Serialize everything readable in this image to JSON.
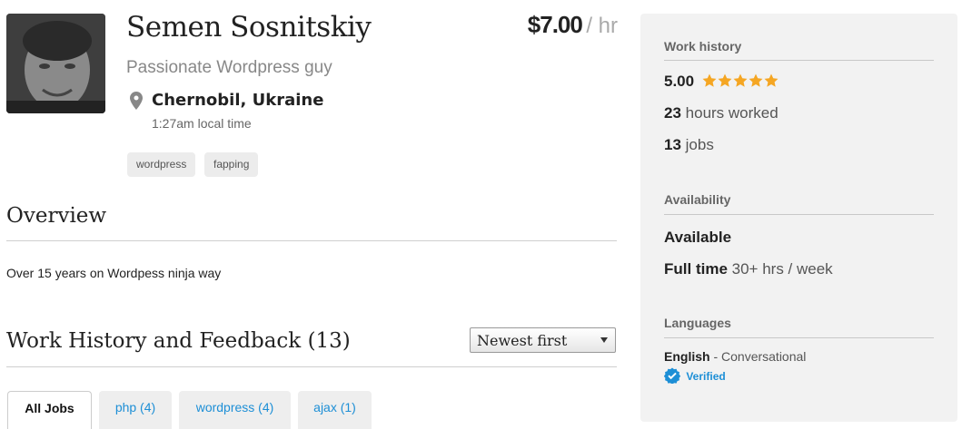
{
  "profile": {
    "name": "Semen Sosnitskiy",
    "tagline": "Passionate Wordpress guy",
    "location": "Chernobil, Ukraine",
    "local_time": "1:27am local time",
    "skills": [
      "wordpress",
      "fapping"
    ],
    "rate_amount": "$7.00",
    "rate_unit": "/ hr"
  },
  "overview": {
    "heading": "Overview",
    "text": "Over 15 years on Wordpess ninja way"
  },
  "work_history": {
    "heading": "Work History and Feedback",
    "count": "(13)",
    "sort_value": "Newest first",
    "tabs": [
      {
        "label": "All Jobs",
        "active": true
      },
      {
        "label": "php (4)",
        "active": false
      },
      {
        "label": "wordpress (4)",
        "active": false
      },
      {
        "label": "ajax (1)",
        "active": false
      }
    ]
  },
  "sidebar": {
    "work_history_heading": "Work history",
    "rating": "5.00",
    "rating_stars": 5,
    "hours_value": "23",
    "hours_label": "hours worked",
    "jobs_value": "13",
    "jobs_label": "jobs",
    "availability_heading": "Availability",
    "availability_status": "Available",
    "availability_type": "Full time",
    "availability_hours": "30+ hrs / week",
    "languages_heading": "Languages",
    "language_name": "English",
    "language_level": "Conversational",
    "verified_label": "Verified"
  },
  "colors": {
    "link": "#1d8fd6",
    "star": "#f5a623",
    "sidebar_bg": "#f2f2f2"
  },
  "icons": [
    "map-pin-icon",
    "star-icon",
    "verified-check-icon",
    "chevron-down-icon"
  ]
}
